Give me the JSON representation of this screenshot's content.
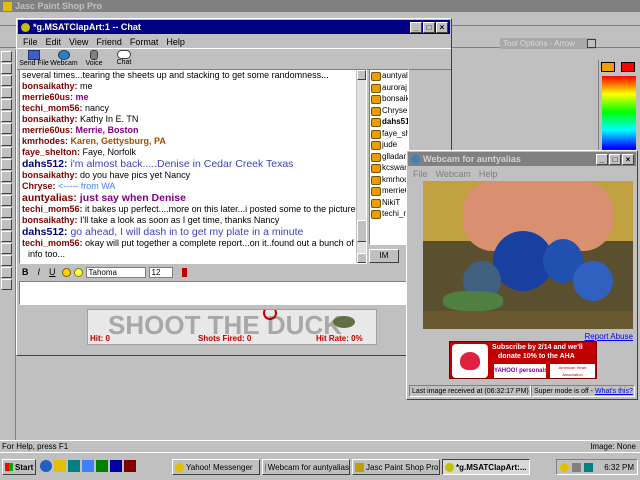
{
  "psp": {
    "title": "Jasc Paint Shop Pro",
    "tool_options": "Tool Options - Arrow",
    "status_left": "For Help, press F1",
    "status_right": "Image: None"
  },
  "chat": {
    "title": "*g.MSATClapArt:1 -- Chat",
    "menu": [
      "File",
      "Edit",
      "View",
      "Friend",
      "Format",
      "Help"
    ],
    "toolbar": [
      {
        "label": "Send File",
        "icon": "send-file-icon"
      },
      {
        "label": "Webcam",
        "icon": "webcam-icon"
      },
      {
        "label": "Voice",
        "icon": "voice-icon"
      },
      {
        "label": "Chat",
        "icon": "chat-icon"
      }
    ],
    "messages": [
      {
        "user": "",
        "text": "several times...tearing the sheets up and stacking to get some randomness...",
        "color": "#000000",
        "textcolor": "#000000",
        "style": "normal"
      },
      {
        "user": "bonsaikathy:",
        "text": " me",
        "color": "#800000",
        "textcolor": "#000000",
        "style": "normal"
      },
      {
        "user": "merrie60us:",
        "text": " me",
        "color": "#800000",
        "textcolor": "#800080",
        "style": "bold"
      },
      {
        "user": "techi_mom56:",
        "text": " nancy",
        "color": "#800000",
        "textcolor": "#000000",
        "style": "normal"
      },
      {
        "user": "bonsaikathy:",
        "text": " Kathy In E. TN",
        "color": "#800000",
        "textcolor": "#000000",
        "style": "normal"
      },
      {
        "user": "merrie60us:",
        "text": " Merrie, Boston",
        "color": "#800000",
        "textcolor": "#800080",
        "style": "bold"
      },
      {
        "user": "kmrhodes:",
        "text": " Karen, Gettysburg, PA",
        "color": "#800000",
        "textcolor": "#a05000",
        "style": "bold"
      },
      {
        "user": "faye_shelton:",
        "text": " Faye, Norfolk",
        "color": "#800000",
        "textcolor": "#000000",
        "style": "normal"
      },
      {
        "user": "dahs512:",
        "text": " i'm almost back.....Denise in Cedar Creek Texas",
        "color": "#000080",
        "textcolor": "#4040c0",
        "style": "big"
      },
      {
        "user": "bonsaikathy:",
        "text": " do you have pics yet Nancy",
        "color": "#800000",
        "textcolor": "#000000",
        "style": "normal"
      },
      {
        "user": "Chryse:",
        "text": " <----- from WA",
        "color": "#800000",
        "textcolor": "#4080ff",
        "style": "normal"
      },
      {
        "user": "auntyalias:",
        "text": " just say when Denise",
        "color": "#800000",
        "textcolor": "#800080",
        "style": "bigbold"
      },
      {
        "user": "techi_mom56:",
        "text": " it bakes up perfect....more on this later...i posted some to the pictures group",
        "color": "#800000",
        "textcolor": "#000000",
        "style": "normal"
      },
      {
        "user": "bonsaikathy:",
        "text": " I'll take a look as soon as I get time, thanks Nancy",
        "color": "#800000",
        "textcolor": "#000000",
        "style": "normal"
      },
      {
        "user": "dahs512:",
        "text": " go ahead, I will dash in to get my plate in a minute",
        "color": "#000080",
        "textcolor": "#4040c0",
        "style": "big"
      },
      {
        "user": "techi_mom56:",
        "text": " okay will put together a complete report...on it..found out a bunch of other",
        "color": "#800000",
        "textcolor": "#000000",
        "style": "normal"
      },
      {
        "user": "",
        "text": "info too...",
        "color": "#000000",
        "textcolor": "#000000",
        "style": "indent"
      }
    ],
    "users": [
      "auntyalias",
      "auroraj",
      "bonsaikathy",
      "Chryse",
      "dahs512",
      "faye_shelton",
      "jude",
      "glladams",
      "kcswartz",
      "kmrhodes",
      "merrie60",
      "NikiT",
      "techi_m"
    ],
    "im_button": "IM",
    "format_font": "Tahoma",
    "format_size": "12",
    "format_buttons": [
      "B",
      "I",
      "U"
    ],
    "ad_text": "SHOOT THE DUCK",
    "ad_hit": "Hit: 0",
    "ad_shots": "Shots Fired: 0",
    "ad_rate": "Hit Rate: 0%"
  },
  "webcam": {
    "title": "Webcam for auntyalias",
    "menu": [
      "File",
      "Webcam",
      "Help"
    ],
    "report_abuse": "Report Abuse",
    "ad_line1": "Subscribe by 2/14 and we'll",
    "ad_line2": "donate 10% to the AHA",
    "ad_brand": "YAHOO! personals",
    "ad_aha": "American Heart Association",
    "status_left": "Last image received at (06:32:17 PM)",
    "status_right_prefix": "Super mode is off - ",
    "status_right_link": "What's this?"
  },
  "taskbar": {
    "start": "Start",
    "buttons": [
      "Yahoo! Messenger",
      "Webcam for auntyalias",
      "Jasc Paint Shop Pro",
      "*g.MSATClapArt:..."
    ],
    "clock": "6:32 PM"
  },
  "colors": {
    "title_active": "#000080",
    "title_inactive": "#808080",
    "face": "#c0c0c0",
    "link": "#0000ff"
  }
}
